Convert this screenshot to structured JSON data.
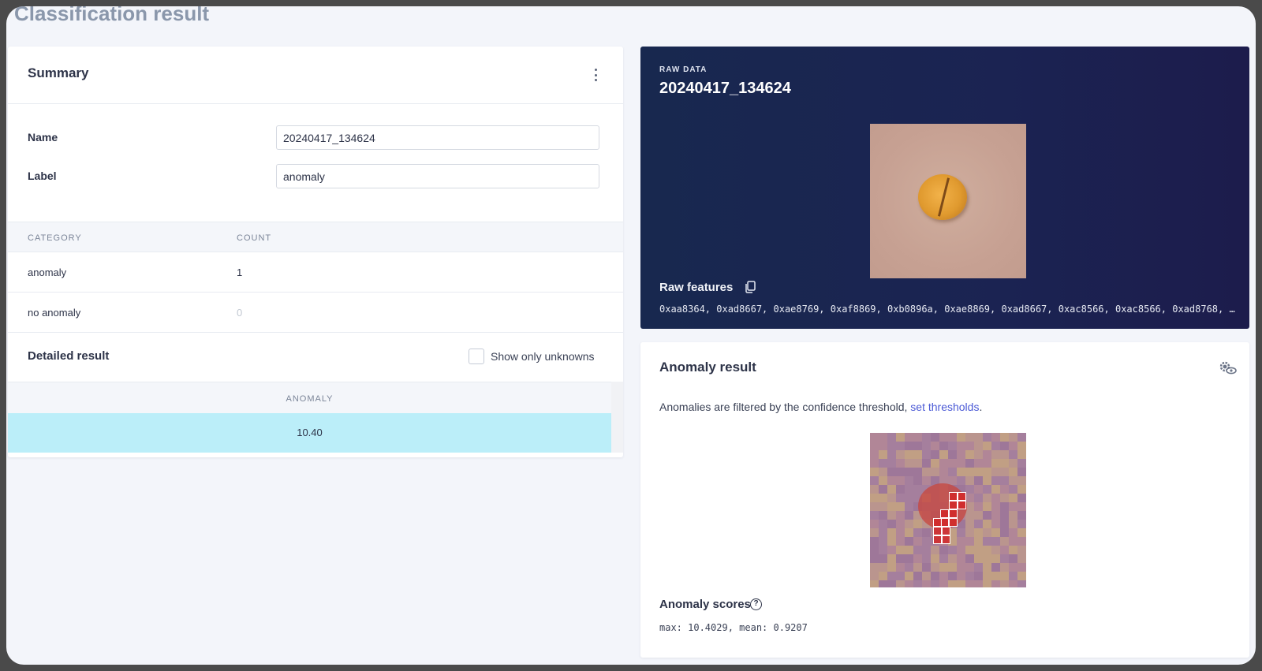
{
  "page": {
    "title": "Classification result"
  },
  "summary": {
    "title": "Summary",
    "menu_icon": "kebab-icon",
    "name_label": "Name",
    "name_value": "20240417_134624",
    "label_label": "Label",
    "label_value": "anomaly",
    "table": {
      "headers": [
        "CATEGORY",
        "COUNT"
      ],
      "rows": [
        {
          "category": "anomaly",
          "count": "1"
        },
        {
          "category": "no anomaly",
          "count": "0"
        }
      ]
    }
  },
  "detailed": {
    "title": "Detailed result",
    "show_unknowns_label": "Show only unknowns",
    "show_unknowns_checked": false,
    "column": "ANOMALY",
    "value": "10.40",
    "highlight_color": "#bbeef9"
  },
  "raw_data": {
    "kicker": "RAW DATA",
    "title": "20240417_134624",
    "features_label": "Raw features",
    "copy_icon": "copy-icon",
    "features_text": "0xaa8364, 0xad8667, 0xae8769, 0xaf8869, 0xb0896a, 0xae8869, 0xad8667, 0xac8566, 0xac8566, 0xad8768, …"
  },
  "anomaly": {
    "title": "Anomaly result",
    "settings_icon": "settings-eye-icon",
    "description": "Anomalies are filtered by the confidence threshold,",
    "link_text": "set thresholds",
    "link_suffix": ".",
    "scores_label": "Anomaly scores",
    "help_icon": "help-circle-icon",
    "help_glyph": "?",
    "scores_text": "max: 10.4029, mean: 0.9207"
  },
  "colors": {
    "raw_card_bg": "#18284f",
    "link": "#4b5ad6",
    "heat_hot": "#d22828"
  }
}
